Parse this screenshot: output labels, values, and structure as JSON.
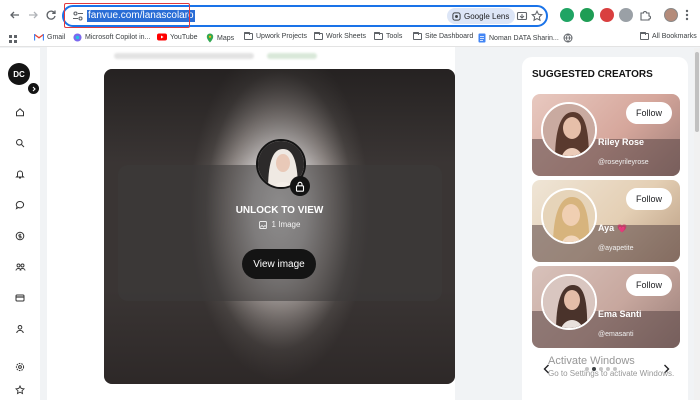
{
  "browser": {
    "url": "fanvue.com/lanascolaro",
    "lens_label": "Google Lens",
    "bookmarks": [
      "Gmail",
      "Microsoft Copilot in...",
      "YouTube",
      "Maps",
      "Upwork Projects",
      "Work Sheets",
      "Tools",
      "Site Dashboard",
      "Noman DATA Sharin..."
    ],
    "all_bookmarks_label": "All Bookmarks"
  },
  "nav": {
    "logo_text": "DC"
  },
  "post": {
    "unlock_title": "UNLOCK TO VIEW",
    "image_count": "1 Image",
    "view_button": "View image"
  },
  "suggested": {
    "title": "SUGGESTED CREATORS",
    "follow_label": "Follow",
    "creators": [
      {
        "name": "Riley Rose",
        "handle": "@roseyrileyrose"
      },
      {
        "name": "Aya",
        "handle": "@ayapetite",
        "badge": "💗"
      },
      {
        "name": "Ema Santi",
        "handle": "@emasanti"
      }
    ]
  },
  "watermark": {
    "title": "Activate Windows",
    "subtitle": "Go to Settings to activate Windows."
  },
  "colors": {
    "accent": "#1a73e8",
    "highlight": "#e0393e",
    "dark": "#141414"
  }
}
